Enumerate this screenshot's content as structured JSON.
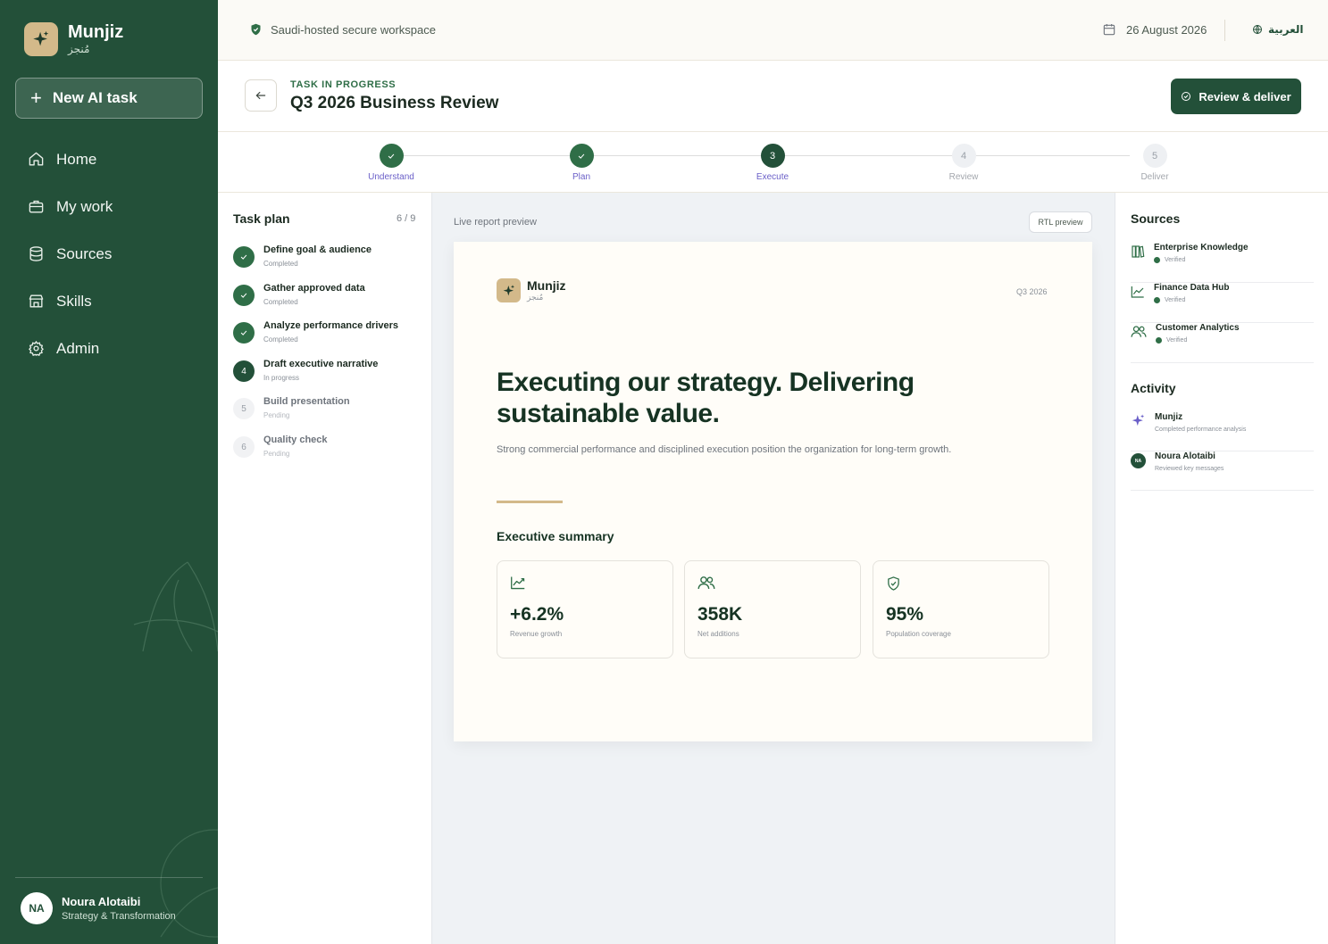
{
  "brand": {
    "name": "Munjiz",
    "sub": "مُنجز"
  },
  "sidebar": {
    "new_task_label": "New AI task",
    "items": [
      {
        "label": "Home",
        "icon": "home-icon"
      },
      {
        "label": "My work",
        "icon": "briefcase-icon"
      },
      {
        "label": "Sources",
        "icon": "database-icon"
      },
      {
        "label": "Skills",
        "icon": "store-icon"
      },
      {
        "label": "Admin",
        "icon": "gear-icon"
      }
    ],
    "user": {
      "initials": "NA",
      "name": "Noura Alotaibi",
      "role": "Strategy & Transformation"
    }
  },
  "topbar": {
    "secure_label": "Saudi-hosted secure workspace",
    "date": "26 August 2026",
    "language": "العربية"
  },
  "header": {
    "status": "TASK IN PROGRESS",
    "title": "Q3 2026 Business Review",
    "review_label": "Review & deliver"
  },
  "stepper": {
    "steps": [
      {
        "num": "1",
        "label": "Understand",
        "state": "done"
      },
      {
        "num": "2",
        "label": "Plan",
        "state": "done"
      },
      {
        "num": "3",
        "label": "Execute",
        "state": "current"
      },
      {
        "num": "4",
        "label": "Review",
        "state": "pending"
      },
      {
        "num": "5",
        "label": "Deliver",
        "state": "pending"
      }
    ]
  },
  "plan": {
    "title": "Task plan",
    "count": "6 / 9",
    "items": [
      {
        "num": "1",
        "name": "Define goal & audience",
        "state": "Completed"
      },
      {
        "num": "2",
        "name": "Gather approved data",
        "state": "Completed"
      },
      {
        "num": "3",
        "name": "Analyze performance drivers",
        "state": "Completed"
      },
      {
        "num": "4",
        "name": "Draft executive narrative",
        "state": "In progress"
      },
      {
        "num": "5",
        "name": "Build presentation",
        "state": "Pending"
      },
      {
        "num": "6",
        "name": "Quality check",
        "state": "Pending"
      }
    ]
  },
  "preview": {
    "label": "Live report preview",
    "rtl_label": "RTL preview",
    "report": {
      "brand_name": "Munjiz",
      "brand_sub": "مُنجز",
      "period": "Q3 2026",
      "headline": "Executing our strategy. Delivering sustainable value.",
      "subheadline": "Strong commercial performance and disciplined execution position the organization for long-term growth.",
      "section_title": "Executive summary",
      "kpis": [
        {
          "value": "+6.2%",
          "label": "Revenue growth",
          "icon": "trend-up-icon"
        },
        {
          "value": "358K",
          "label": "Net additions",
          "icon": "users-icon"
        },
        {
          "value": "95%",
          "label": "Population coverage",
          "icon": "shield-check-icon"
        }
      ]
    }
  },
  "sources": {
    "title": "Sources",
    "items": [
      {
        "name": "Enterprise Knowledge",
        "status": "Verified",
        "icon": "books-icon"
      },
      {
        "name": "Finance Data Hub",
        "status": "Verified",
        "icon": "chart-line-icon"
      },
      {
        "name": "Customer Analytics",
        "status": "Verified",
        "icon": "users-icon"
      }
    ]
  },
  "activity": {
    "title": "Activity",
    "items": [
      {
        "name": "Munjiz",
        "desc": "Completed performance analysis",
        "icon": "sparkle-icon"
      },
      {
        "name": "Noura Alotaibi",
        "desc": "Reviewed key messages",
        "initials": "NA"
      }
    ]
  },
  "colors": {
    "primary": "#235039",
    "accent": "#d3b98a",
    "step_label": "#6a5fc8",
    "sparkle": "#6a5fc8"
  }
}
